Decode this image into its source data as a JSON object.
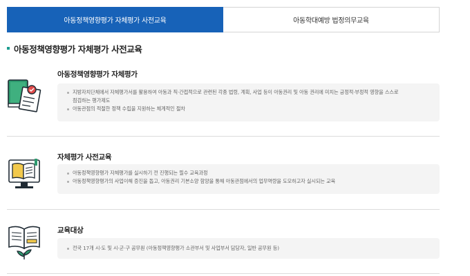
{
  "tabs": [
    {
      "label": "아동정책영향평가 자체평가 사전교육",
      "active": true
    },
    {
      "label": "아동학대예방 법정의무교육",
      "active": false
    }
  ],
  "section_title": "아동정책영향평가 자체평가 사전교육",
  "blocks": [
    {
      "icon": "book-checklist-icon",
      "heading": "아동정책영향평가 자체평가",
      "lines": [
        "지방자치단체에서 자체평가서를 활용하여 아동과 직·간접적으로 관련된 각종 법령, 계획, 사업 등이 아동권리 및 아동 권리에 미치는 긍정적·부정적 영향을 스스로",
        "점검하는 평가제도",
        "아동관점의 적절한 정책 수립을 지원하는 체계적인 절차"
      ]
    },
    {
      "icon": "online-book-icon",
      "heading": "자체평가 사전교육",
      "lines": [
        "아동정책영향평가 자체평가를 실시하기 전 진행되는 필수 교육과정",
        "아동정책영향평가의 사업이해 증진을 돕고, 아동권리 기본소양 함양을 통해 아동관점에서의 업무역량을 도모하고자 실시되는 교육"
      ]
    },
    {
      "icon": "open-book-plant-icon",
      "heading": "교육대상",
      "lines": [
        "전국 17개 시·도 및 시·군·구 공무원 (아동정책영향평가 소관부서 및 사업부서 담당자, 일반 공무원 등)"
      ]
    }
  ],
  "colors": {
    "accent": "#1762b8",
    "teal": "#1d9c8f",
    "yellow": "#f2c94c",
    "red": "#e04b4b"
  }
}
